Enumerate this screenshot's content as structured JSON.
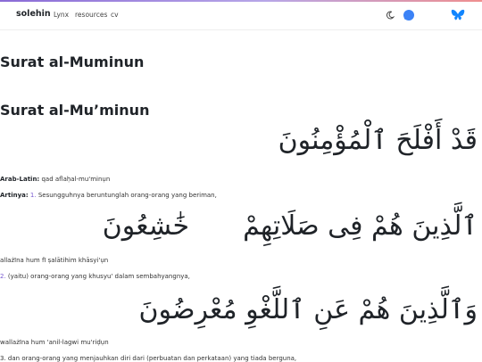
{
  "nav": {
    "brand": "solehin",
    "links": [
      "Lynx",
      "resources",
      "cv"
    ],
    "icons": {
      "theme": "moon-icon",
      "chat": "chat-bubble-icon",
      "social": "bluesky-butterfly-icon"
    },
    "accent": "#3b82f6"
  },
  "page": {
    "title": "Surat al-Muminun",
    "surah_title": "Surat al-Mu’minun"
  },
  "verses": [
    {
      "arabic": "قَدْ أَفْلَحَ ٱلْمُؤْمِنُونَ",
      "latin_label": "Arab-Latin:",
      "latin": "qad aflaḥal-mu'minụn",
      "translation_label": "Artinya:",
      "number": "1.",
      "translation": "Sesungguhnya beruntunglah orang-orang yang beriman,"
    },
    {
      "arabic_right": "ٱلَّذِينَ هُمْ فِى صَلَاتِهِمْ",
      "arabic_left": "خَٰشِعُونَ",
      "latin": "allażīna hum fī ṣalātihim khāsyi'ụn",
      "number": "2.",
      "translation": "(yaitu) orang-orang yang khusyu' dalam sembahyangnya,"
    },
    {
      "arabic": "وَٱلَّذِينَ هُمْ عَنِ ٱللَّغْوِ مُعْرِضُونَ",
      "latin": "wallażīna hum 'anil-lagwi mu'riḍụn",
      "number": "3.",
      "translation": "dan orang-orang yang menjauhkan diri dari (perbuatan dan perkataan) yang tiada berguna,"
    }
  ]
}
